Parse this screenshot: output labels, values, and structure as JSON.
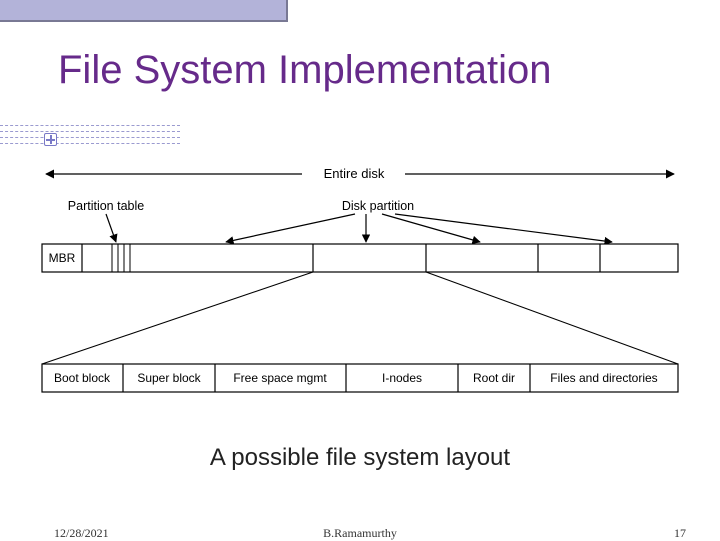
{
  "header": {
    "title": "File System Implementation"
  },
  "caption": "A possible file system layout",
  "footer": {
    "date": "12/28/2021",
    "author": "B.Ramamurthy",
    "page": "17"
  },
  "diagram": {
    "top_label": "Entire disk",
    "partition_table_label": "Partition table",
    "disk_partition_label": "Disk partition",
    "mbr_label": "MBR",
    "blocks": {
      "boot": "Boot block",
      "super": "Super block",
      "free": "Free space mgmt",
      "inodes": "I-nodes",
      "root": "Root dir",
      "files": "Files and directories"
    }
  }
}
